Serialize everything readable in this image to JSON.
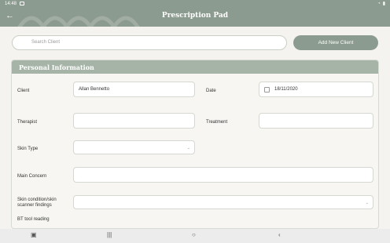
{
  "status": {
    "time": "14:48"
  },
  "appbar": {
    "title": "Prescription Pad",
    "back_icon": "arrow-left-icon"
  },
  "search": {
    "placeholder": "Search Client"
  },
  "add_button": {
    "label": "Add New Client"
  },
  "panel": {
    "title": "Personal Information"
  },
  "form": {
    "client_label": "Client",
    "client_value": "Allan Bennetto",
    "date_label": "Date",
    "date_value": "18/11/2020",
    "therapist_label": "Therapist",
    "treatment_label": "Treatment",
    "skin_type_label": "Skin Type",
    "main_concern_label": "Main Concern",
    "skin_condition_label": "Skin condition/skin scanner findings",
    "bt_tool_label": "BT tool reading"
  },
  "colors": {
    "accent": "#8c9b8f",
    "panel_header": "#a6b4a8",
    "background": "#f4f3ef"
  }
}
